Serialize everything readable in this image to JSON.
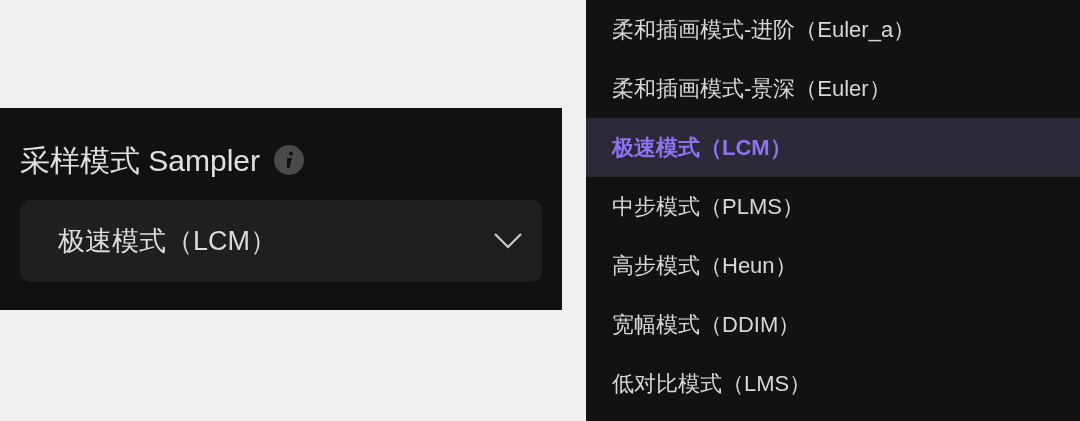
{
  "field": {
    "label": "采样模式 Sampler",
    "value": "极速模式（LCM）"
  },
  "dropdown": {
    "items": [
      {
        "label": "柔和插画模式-进阶（Euler_a）",
        "selected": false
      },
      {
        "label": "柔和插画模式-景深（Euler）",
        "selected": false
      },
      {
        "label": "极速模式（LCM）",
        "selected": true
      },
      {
        "label": "中步模式（PLMS）",
        "selected": false
      },
      {
        "label": "高步模式（Heun）",
        "selected": false
      },
      {
        "label": "宽幅模式（DDIM）",
        "selected": false
      },
      {
        "label": "低对比模式（LMS）",
        "selected": false
      }
    ]
  }
}
